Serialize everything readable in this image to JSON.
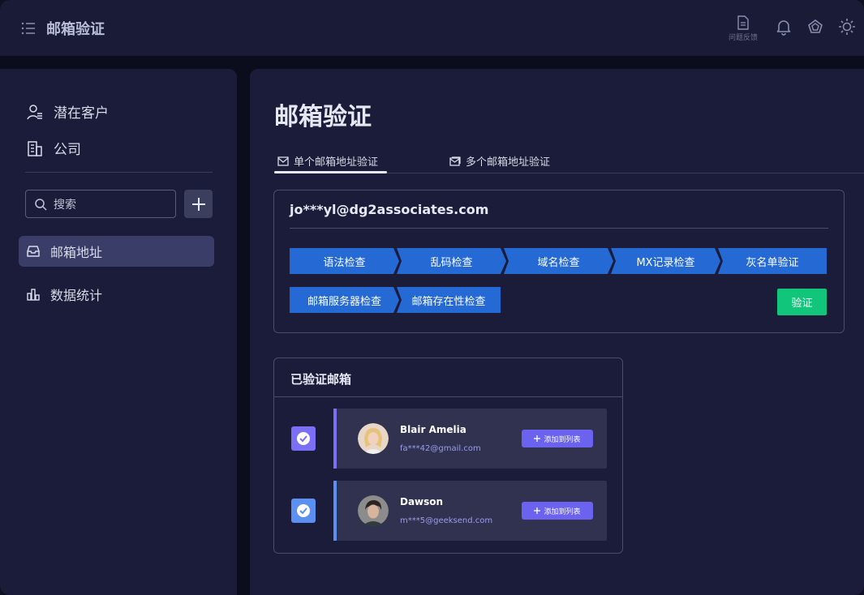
{
  "app": {
    "title": "邮箱验证",
    "feedback_label": "问题反馈"
  },
  "sidebar": {
    "nav": [
      {
        "label": "潜在客户",
        "icon": "users-icon"
      },
      {
        "label": "公司",
        "icon": "building-icon"
      }
    ],
    "search_placeholder": "搜索",
    "menu": [
      {
        "label": "邮箱地址",
        "icon": "inbox-icon",
        "active": true
      },
      {
        "label": "数据统计",
        "icon": "bar-chart-icon",
        "active": false
      }
    ]
  },
  "main": {
    "title": "邮箱验证",
    "tabs": [
      {
        "label": "单个邮箱地址验证",
        "active": true
      },
      {
        "label": "多个邮箱地址验证",
        "active": false
      }
    ],
    "verify": {
      "email": "jo***yl@dg2associates.com",
      "steps_row1": [
        "语法检查",
        "乱码检查",
        "域名检查",
        "MX记录检查",
        "灰名单验证"
      ],
      "steps_row2": [
        "邮箱服务器检查",
        "邮箱存在性检查"
      ],
      "verify_button": "验证"
    },
    "verified": {
      "title": "已验证邮箱",
      "items": [
        {
          "name": "Blair Amelia",
          "email": "fa***42@gmail.com",
          "button": "添加到列表",
          "bar_color": "#7b6ff5"
        },
        {
          "name": "Dawson",
          "email": "m***5@geeksend.com",
          "button": "添加到列表",
          "bar_color": "#5b8ff0"
        }
      ]
    }
  },
  "colors": {
    "accent": "#2569d4",
    "success": "#11c57a",
    "button": "#6b63f0"
  }
}
